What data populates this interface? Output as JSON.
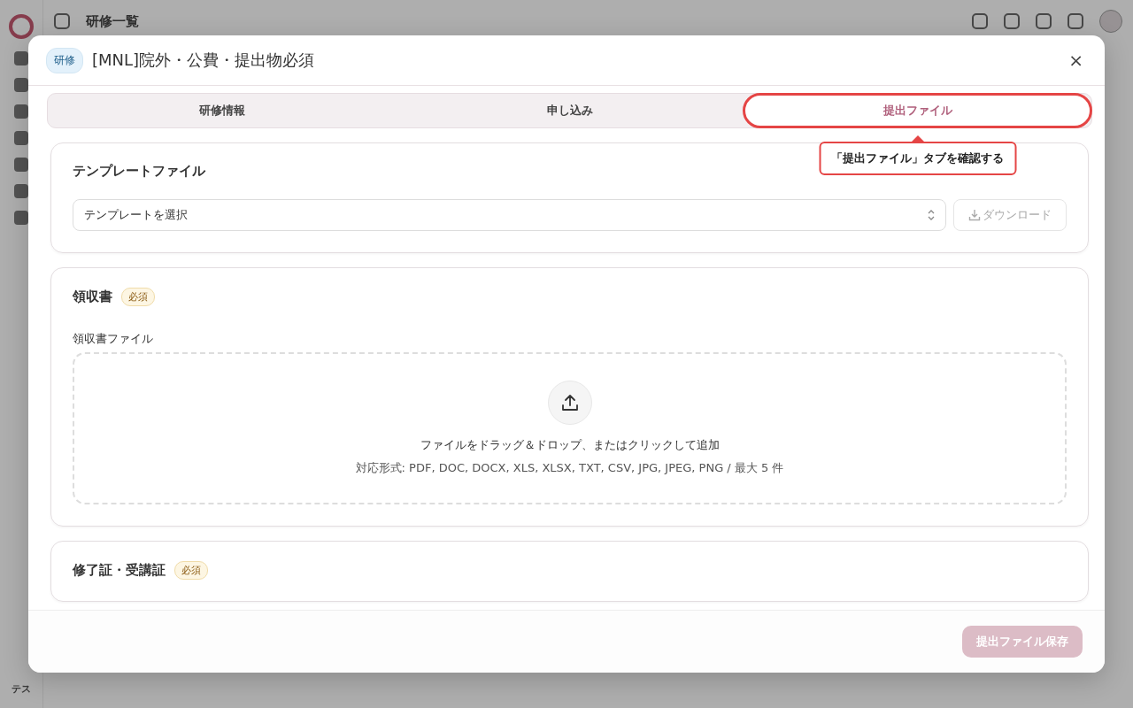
{
  "background": {
    "page_title": "研修一覧",
    "user_label": "テス"
  },
  "dialog": {
    "category_badge": "研修",
    "title": "[MNL]院外・公費・提出物必須",
    "close_icon": "×"
  },
  "tabs": [
    {
      "label": "研修情報",
      "selected": false,
      "highlighted": false
    },
    {
      "label": "申し込み",
      "selected": false,
      "highlighted": false
    },
    {
      "label": "提出ファイル",
      "selected": true,
      "highlighted": true
    }
  ],
  "callout": {
    "text": "「提出ファイル」タブを確認する"
  },
  "sections": [
    {
      "kind": "template",
      "title": "テンプレートファイル",
      "select_placeholder": "テンプレートを選択",
      "download_button": {
        "label": "ダウンロード",
        "disabled": true
      }
    },
    {
      "kind": "upload",
      "title": "領収書",
      "required_badge": "必須",
      "field_label": "領収書ファイル",
      "drop_text": "ファイルをドラッグ＆ドロップ、またはクリックして追加",
      "formats_text": "対応形式: PDF, DOC, DOCX, XLS, XLSX, TXT, CSV, JPG, JPEG, PNG / 最大 5 件"
    },
    {
      "kind": "upload",
      "title": "修了証・受講証",
      "required_badge": "必須"
    }
  ],
  "footer": {
    "save_button": {
      "label": "提出ファイル保存",
      "disabled": true
    }
  }
}
